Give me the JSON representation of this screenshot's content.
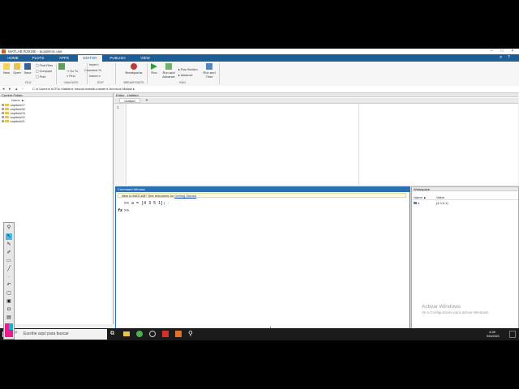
{
  "window": {
    "title": "MATLAB R2018b - academic use"
  },
  "tabs": [
    "HOME",
    "PLOTS",
    "APPS",
    "EDITOR",
    "PUBLISH",
    "VIEW"
  ],
  "active_tab": "EDITOR",
  "search": {
    "placeholder": "Search Documentation"
  },
  "toolstrip": {
    "new": "New",
    "open": "Open",
    "save": "Save",
    "find_files": "Find Files",
    "compare": "Compare",
    "print": "Print",
    "go_to": "Go To",
    "find": "Find",
    "insert": "Insert",
    "comment": "Comment",
    "indent": "Indent",
    "breakpoints": "Breakpoints",
    "run": "Run",
    "run_advance": "Run and Advance",
    "run_section": "Run Section",
    "advance": "Advance",
    "run_time": "Run and Time",
    "sections": {
      "file": "FILE",
      "navigate": "NAVIGATE",
      "edit": "EDIT",
      "breakpoints": "BREAKPOINTS",
      "run": "RUN"
    }
  },
  "address": {
    "path": "C: ▸ Users ▸ ACR ▸ Matlab ▸ tutorial-matlab-master ▸ Archivos Matlab ▸"
  },
  "current_folder": {
    "header": "Current Folder",
    "column": "Name ▲",
    "items": [
      "capitulo07",
      "capitulo06",
      "capitulo03",
      "capitulo02",
      "capitulo01"
    ]
  },
  "editor": {
    "header": "Editor - Untitled",
    "tab": "Untitled",
    "plus": "+",
    "line_number": "1"
  },
  "command_window": {
    "header": "Command Window",
    "notice_text": "New to MATLAB? See resources for",
    "notice_link": "Getting Started",
    "line1": ">> a = [4 3 5 1];",
    "prompt_fx": "fx",
    "prompt": ">>"
  },
  "workspace": {
    "header": "Workspace",
    "col_name": "Name ▲",
    "col_value": "Value",
    "var_name": "a",
    "var_value": "[4,3,5,1]"
  },
  "taskbar": {
    "search": "Escribe aquí para buscar",
    "time": "4:28",
    "date": "9/04/2020"
  },
  "watermark": {
    "title": "Activar Windows",
    "subtitle": "Ve a Configuración para activar Windows."
  },
  "colors": {
    "tab_bar": "#1d5d95",
    "cmd_border": "#2b6fb5",
    "folder": "#e9c24f"
  }
}
